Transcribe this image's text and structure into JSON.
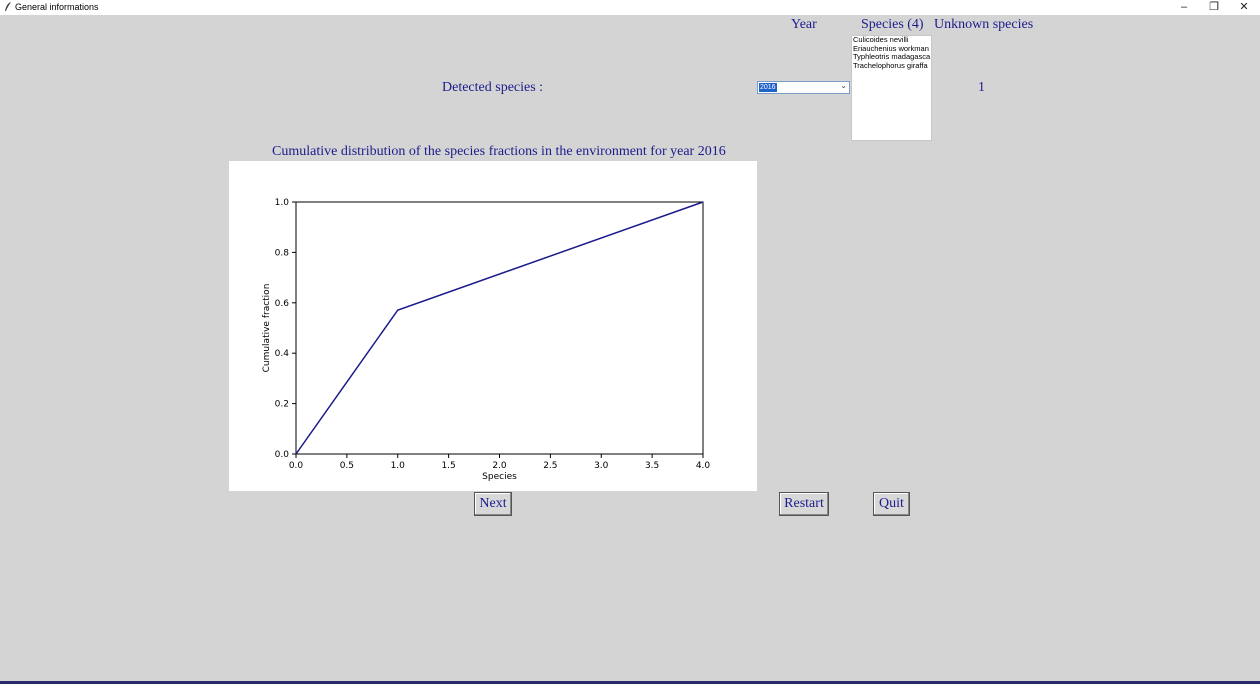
{
  "window": {
    "title": "General informations",
    "minimize": "–",
    "restore": "❐",
    "close": "✕"
  },
  "header": {
    "year_label": "Year",
    "species_label": "Species (4)",
    "unknown_label": "Unknown species"
  },
  "detected_label": "Detected species :",
  "year_select": {
    "value": "2016",
    "arrow": "⌄"
  },
  "species_list": [
    "Culicoides nevilli",
    "Eriauchenius workman",
    "Typhleotris madagasca",
    "Trachelophorus giraffa"
  ],
  "unknown_count": "1",
  "chart_title": "Cumulative distribution of the species fractions in the environment for year 2016",
  "chart_data": {
    "type": "line",
    "x": [
      0,
      1,
      4
    ],
    "series": [
      {
        "values": [
          0.0,
          0.571,
          1.0
        ],
        "color": "#1a1a8c"
      }
    ],
    "xlabel": "Species",
    "ylabel": "Cumulative fraction",
    "xlim": [
      0,
      4
    ],
    "ylim": [
      0,
      1
    ],
    "xticks": [
      "0.0",
      "0.5",
      "1.0",
      "1.5",
      "2.0",
      "2.5",
      "3.0",
      "3.5",
      "4.0"
    ],
    "yticks": [
      "0.0",
      "0.2",
      "0.4",
      "0.6",
      "0.8",
      "1.0"
    ],
    "grid": false
  },
  "buttons": {
    "next": "Next",
    "restart": "Restart",
    "quit": "Quit"
  }
}
